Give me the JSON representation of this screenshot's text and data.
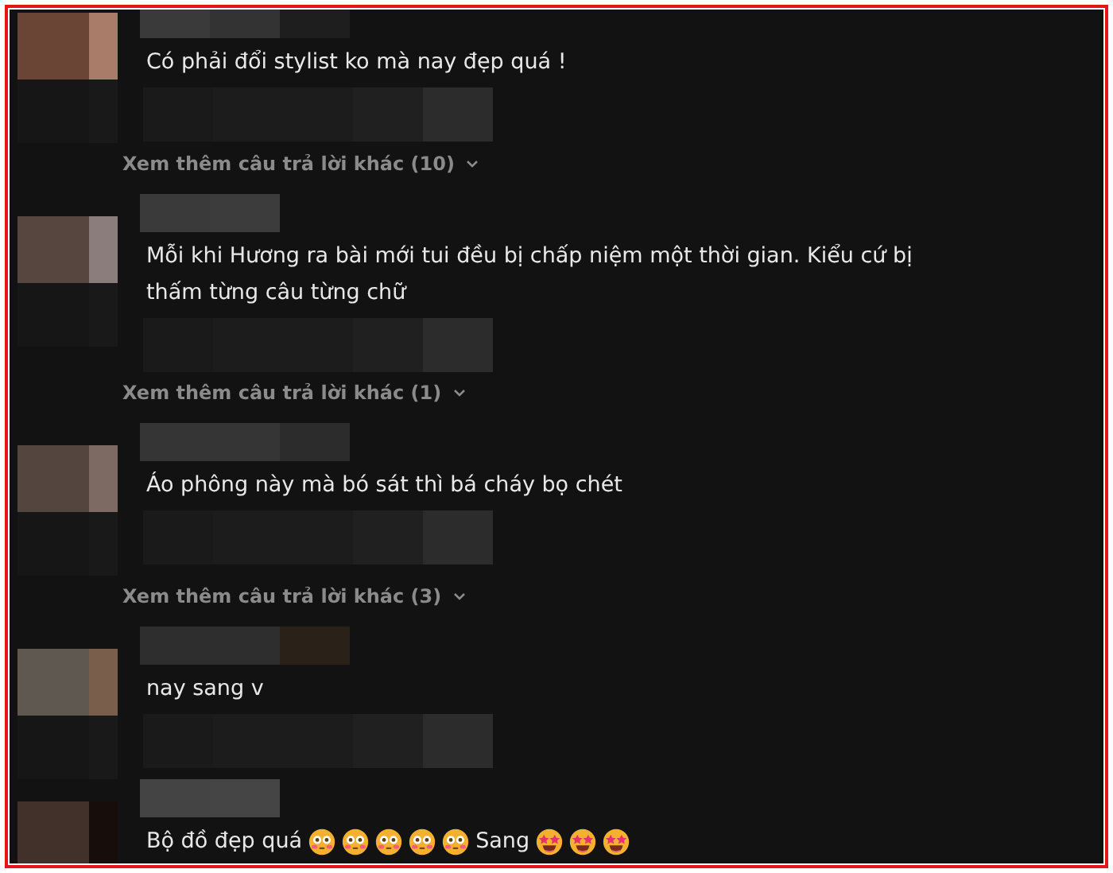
{
  "comments": [
    {
      "segments": [
        {
          "kind": "text",
          "text": "Có phải đổi stylist ko mà nay đẹp quá !"
        }
      ],
      "more_replies": "Xem thêm câu trả lời khác (10)"
    },
    {
      "segments": [
        {
          "kind": "text",
          "text": "Mỗi khi Hương ra bài mới tui đều bị chấp niệm một thời gian. Kiểu cứ bị thấm từng câu từng chữ"
        }
      ],
      "more_replies": "Xem thêm câu trả lời khác (1)"
    },
    {
      "segments": [
        {
          "kind": "text",
          "text": "Áo phông này mà bó sát thì bá cháy bọ chét"
        }
      ],
      "more_replies": "Xem thêm câu trả lời khác (3)"
    },
    {
      "segments": [
        {
          "kind": "text",
          "text": "nay sang v"
        }
      ]
    },
    {
      "segments": [
        {
          "kind": "text",
          "text": "Bộ đồ đẹp quá"
        },
        {
          "kind": "flushed"
        },
        {
          "kind": "flushed"
        },
        {
          "kind": "flushed"
        },
        {
          "kind": "flushed"
        },
        {
          "kind": "flushed"
        },
        {
          "kind": "text",
          "text": "Sang"
        },
        {
          "kind": "starstruck"
        },
        {
          "kind": "starstruck"
        },
        {
          "kind": "starstruck"
        }
      ]
    }
  ]
}
